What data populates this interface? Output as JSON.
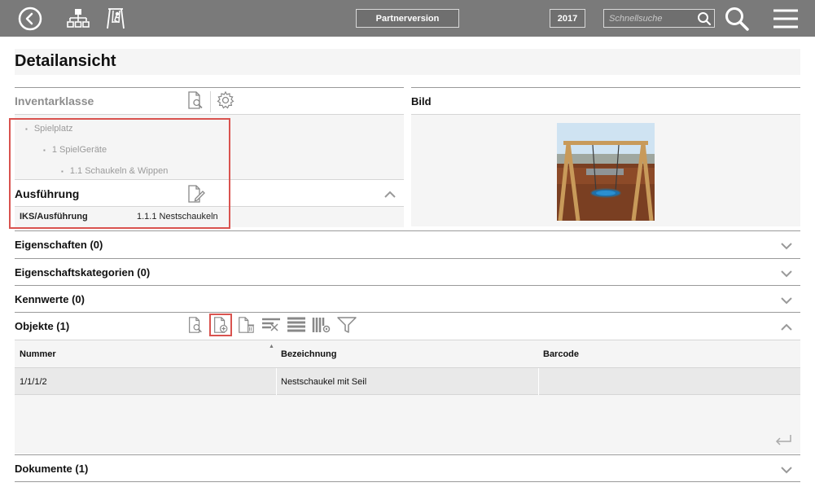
{
  "topbar": {
    "back_icon": "back-arrow-circle-icon",
    "sitemap_icon": "sitemap-icon",
    "playground_icon": "swing-person-icon",
    "partner_label": "Partnerversion",
    "year": "2017",
    "search_placeholder": "Schnellsuche",
    "search_icon": "search-icon",
    "big_search_icon": "big-search-icon",
    "menu_icon": "hamburger-menu-icon",
    "colors": {
      "bar": "#7a7a7a",
      "text": "#ffffff"
    }
  },
  "page": {
    "title": "Detailansicht"
  },
  "inventarklasse": {
    "title": "Inventarklasse",
    "tree": [
      "Spielplatz",
      "1 SpielGeräte",
      "1.1 Schaukeln & Wippen"
    ]
  },
  "ausfuehrung": {
    "title": "Ausführung",
    "row": {
      "key": "IKS/Ausführung",
      "value": "1.1.1 Nestschaukeln"
    }
  },
  "bild": {
    "title": "Bild"
  },
  "sections": {
    "eigenschaften": "Eigenschaften (0)",
    "eigenschaftskategorien": "Eigenschaftskategorien (0)",
    "kennwerte": "Kennwerte (0)",
    "objekte": "Objekte (1)",
    "dokumente": "Dokumente (1)"
  },
  "objekte_table": {
    "columns": [
      "Nummer",
      "Bezeichnung",
      "Barcode"
    ],
    "rows": [
      {
        "nummer": "1/1/1/2",
        "bezeichnung": "Nestschaukel mit Seil",
        "barcode": ""
      }
    ]
  },
  "highlight_color": "#d9534f"
}
